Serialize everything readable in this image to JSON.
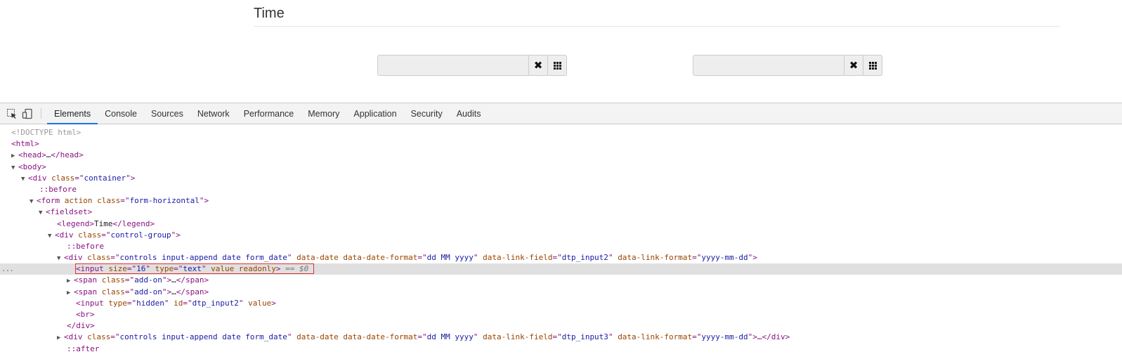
{
  "page": {
    "legend": "Time"
  },
  "datepickers": [
    {
      "value": "",
      "clear_icon": "close-icon",
      "cal_icon": "grid-icon"
    },
    {
      "value": "",
      "clear_icon": "close-icon",
      "cal_icon": "grid-icon"
    }
  ],
  "devtools": {
    "tabs": [
      "Elements",
      "Console",
      "Sources",
      "Network",
      "Performance",
      "Memory",
      "Application",
      "Security",
      "Audits"
    ],
    "active_tab": "Elements",
    "selected_suffix": " == $0",
    "ellipsis": "...",
    "dom": {
      "doctype": "<!DOCTYPE html>",
      "html": "<html>",
      "head_open": "<head>",
      "head_ell": "…",
      "head_close": "</head>",
      "body": "<body>",
      "div": "<div",
      "class_attr": "class",
      "container": "container",
      "before": "::before",
      "after": "::after",
      "form": "<form",
      "action_attr": "action",
      "form_horizontal": "form-horizontal",
      "fieldset": "<fieldset>",
      "legend_open": "<legend>",
      "legend_text": "Time",
      "legend_close": "</legend>",
      "control_group": "control-group",
      "controls_class": "controls input-append date form_date",
      "data_date": "data-date",
      "data_date_format_attr": "data-date-format",
      "date_format": "dd MM yyyy",
      "link_field_attr": "data-link-field",
      "link_field_1": "dtp_input2",
      "link_field_2": "dtp_input3",
      "link_format_attr": "data-link-format",
      "link_format": "yyyy-mm-dd",
      "input": "<input",
      "size_attr": "size",
      "size_val": "16",
      "type_attr": "type",
      "type_text": "text",
      "type_hidden": "hidden",
      "value_attr": "value",
      "readonly_attr": "readonly",
      "id_attr": "id",
      "span": "<span",
      "add_on": "add-on",
      "span_ell": "…",
      "span_close": "</span>",
      "br": "<br>",
      "div_close": "</div>",
      "div_ell_close": "…</div>"
    }
  }
}
